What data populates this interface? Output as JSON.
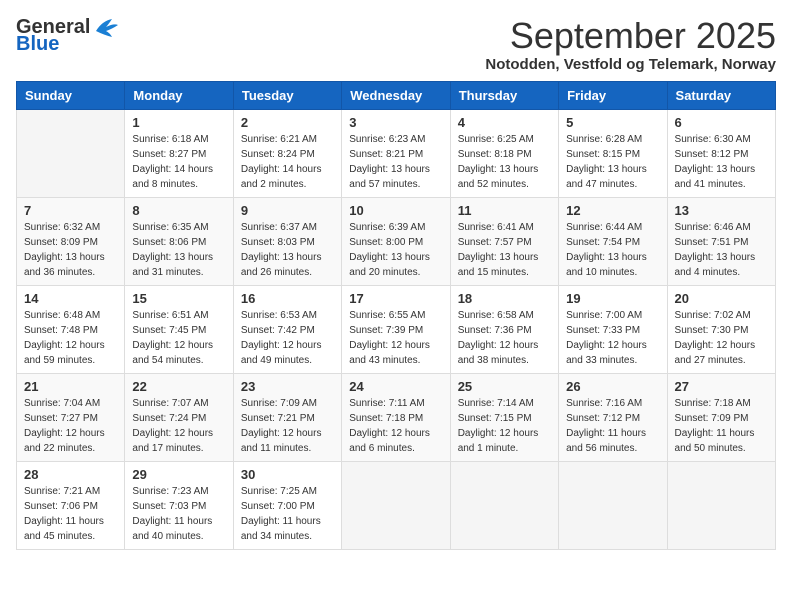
{
  "logo": {
    "general": "General",
    "blue": "Blue"
  },
  "title": "September 2025",
  "subtitle": "Notodden, Vestfold og Telemark, Norway",
  "headers": [
    "Sunday",
    "Monday",
    "Tuesday",
    "Wednesday",
    "Thursday",
    "Friday",
    "Saturday"
  ],
  "weeks": [
    [
      {
        "day": "",
        "info": ""
      },
      {
        "day": "1",
        "info": "Sunrise: 6:18 AM\nSunset: 8:27 PM\nDaylight: 14 hours\nand 8 minutes."
      },
      {
        "day": "2",
        "info": "Sunrise: 6:21 AM\nSunset: 8:24 PM\nDaylight: 14 hours\nand 2 minutes."
      },
      {
        "day": "3",
        "info": "Sunrise: 6:23 AM\nSunset: 8:21 PM\nDaylight: 13 hours\nand 57 minutes."
      },
      {
        "day": "4",
        "info": "Sunrise: 6:25 AM\nSunset: 8:18 PM\nDaylight: 13 hours\nand 52 minutes."
      },
      {
        "day": "5",
        "info": "Sunrise: 6:28 AM\nSunset: 8:15 PM\nDaylight: 13 hours\nand 47 minutes."
      },
      {
        "day": "6",
        "info": "Sunrise: 6:30 AM\nSunset: 8:12 PM\nDaylight: 13 hours\nand 41 minutes."
      }
    ],
    [
      {
        "day": "7",
        "info": "Sunrise: 6:32 AM\nSunset: 8:09 PM\nDaylight: 13 hours\nand 36 minutes."
      },
      {
        "day": "8",
        "info": "Sunrise: 6:35 AM\nSunset: 8:06 PM\nDaylight: 13 hours\nand 31 minutes."
      },
      {
        "day": "9",
        "info": "Sunrise: 6:37 AM\nSunset: 8:03 PM\nDaylight: 13 hours\nand 26 minutes."
      },
      {
        "day": "10",
        "info": "Sunrise: 6:39 AM\nSunset: 8:00 PM\nDaylight: 13 hours\nand 20 minutes."
      },
      {
        "day": "11",
        "info": "Sunrise: 6:41 AM\nSunset: 7:57 PM\nDaylight: 13 hours\nand 15 minutes."
      },
      {
        "day": "12",
        "info": "Sunrise: 6:44 AM\nSunset: 7:54 PM\nDaylight: 13 hours\nand 10 minutes."
      },
      {
        "day": "13",
        "info": "Sunrise: 6:46 AM\nSunset: 7:51 PM\nDaylight: 13 hours\nand 4 minutes."
      }
    ],
    [
      {
        "day": "14",
        "info": "Sunrise: 6:48 AM\nSunset: 7:48 PM\nDaylight: 12 hours\nand 59 minutes."
      },
      {
        "day": "15",
        "info": "Sunrise: 6:51 AM\nSunset: 7:45 PM\nDaylight: 12 hours\nand 54 minutes."
      },
      {
        "day": "16",
        "info": "Sunrise: 6:53 AM\nSunset: 7:42 PM\nDaylight: 12 hours\nand 49 minutes."
      },
      {
        "day": "17",
        "info": "Sunrise: 6:55 AM\nSunset: 7:39 PM\nDaylight: 12 hours\nand 43 minutes."
      },
      {
        "day": "18",
        "info": "Sunrise: 6:58 AM\nSunset: 7:36 PM\nDaylight: 12 hours\nand 38 minutes."
      },
      {
        "day": "19",
        "info": "Sunrise: 7:00 AM\nSunset: 7:33 PM\nDaylight: 12 hours\nand 33 minutes."
      },
      {
        "day": "20",
        "info": "Sunrise: 7:02 AM\nSunset: 7:30 PM\nDaylight: 12 hours\nand 27 minutes."
      }
    ],
    [
      {
        "day": "21",
        "info": "Sunrise: 7:04 AM\nSunset: 7:27 PM\nDaylight: 12 hours\nand 22 minutes."
      },
      {
        "day": "22",
        "info": "Sunrise: 7:07 AM\nSunset: 7:24 PM\nDaylight: 12 hours\nand 17 minutes."
      },
      {
        "day": "23",
        "info": "Sunrise: 7:09 AM\nSunset: 7:21 PM\nDaylight: 12 hours\nand 11 minutes."
      },
      {
        "day": "24",
        "info": "Sunrise: 7:11 AM\nSunset: 7:18 PM\nDaylight: 12 hours\nand 6 minutes."
      },
      {
        "day": "25",
        "info": "Sunrise: 7:14 AM\nSunset: 7:15 PM\nDaylight: 12 hours\nand 1 minute."
      },
      {
        "day": "26",
        "info": "Sunrise: 7:16 AM\nSunset: 7:12 PM\nDaylight: 11 hours\nand 56 minutes."
      },
      {
        "day": "27",
        "info": "Sunrise: 7:18 AM\nSunset: 7:09 PM\nDaylight: 11 hours\nand 50 minutes."
      }
    ],
    [
      {
        "day": "28",
        "info": "Sunrise: 7:21 AM\nSunset: 7:06 PM\nDaylight: 11 hours\nand 45 minutes."
      },
      {
        "day": "29",
        "info": "Sunrise: 7:23 AM\nSunset: 7:03 PM\nDaylight: 11 hours\nand 40 minutes."
      },
      {
        "day": "30",
        "info": "Sunrise: 7:25 AM\nSunset: 7:00 PM\nDaylight: 11 hours\nand 34 minutes."
      },
      {
        "day": "",
        "info": ""
      },
      {
        "day": "",
        "info": ""
      },
      {
        "day": "",
        "info": ""
      },
      {
        "day": "",
        "info": ""
      }
    ]
  ]
}
